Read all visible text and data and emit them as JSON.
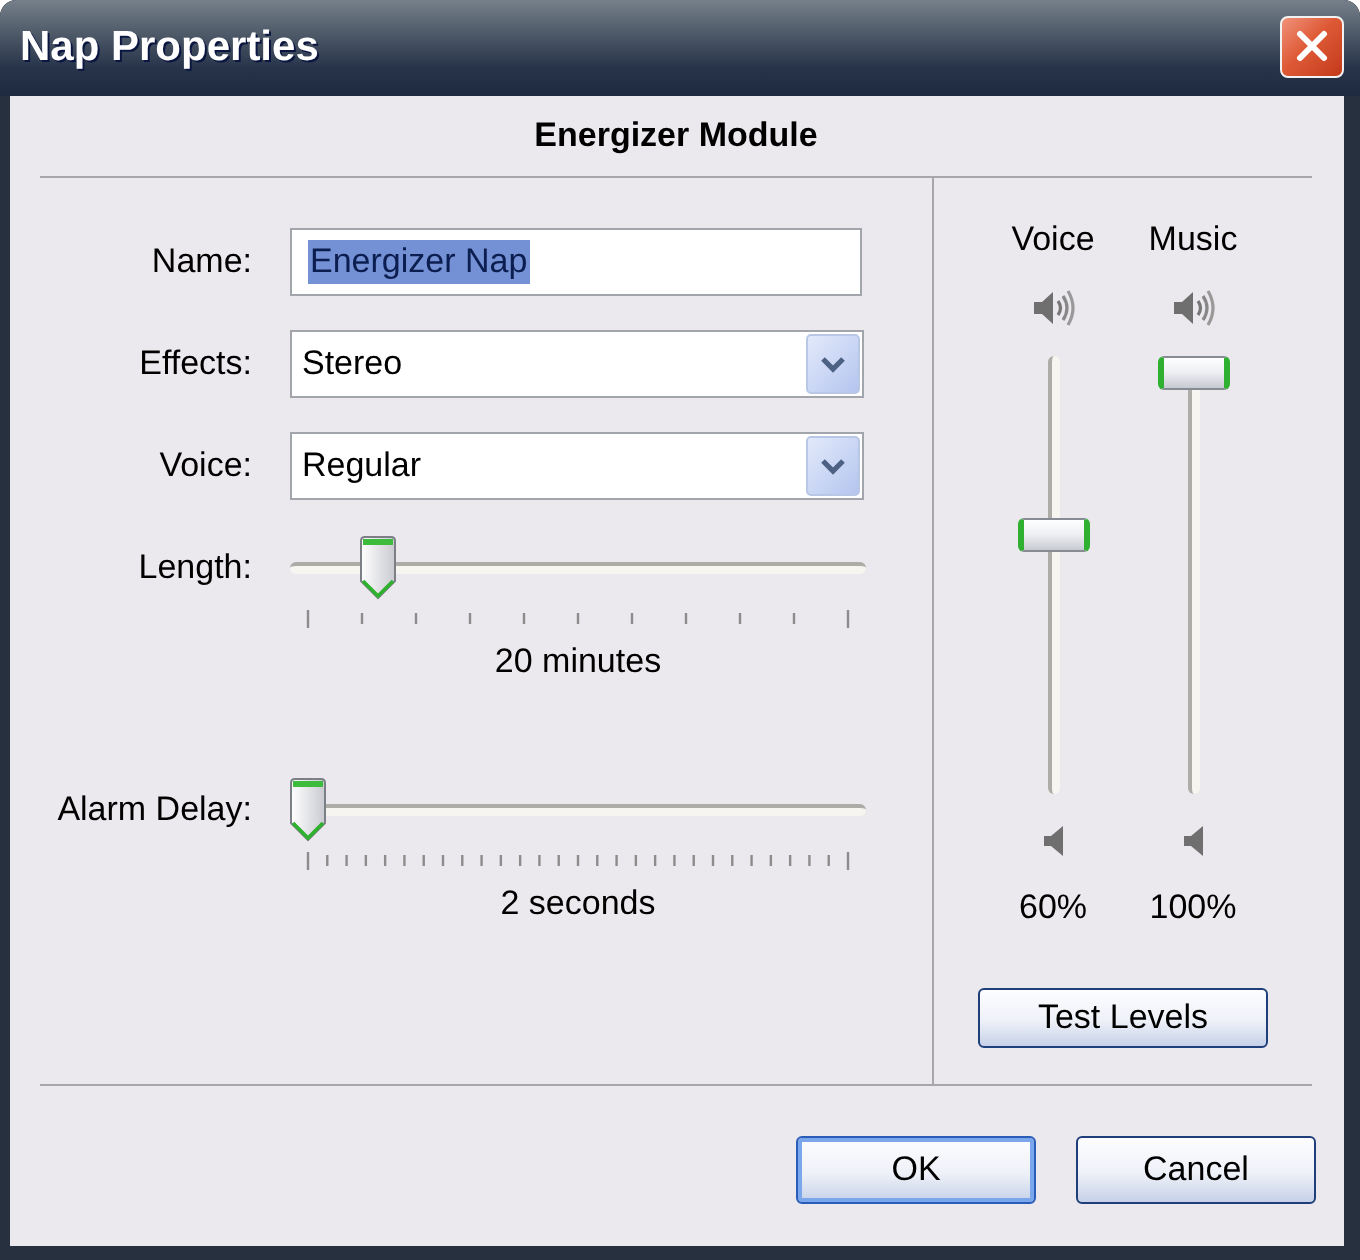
{
  "window": {
    "title": "Nap Properties"
  },
  "heading": "Energizer Module",
  "fields": [
    {
      "kind": "text",
      "label": "Name:",
      "value": "Energizer Nap",
      "value_selected": true
    },
    {
      "kind": "dropdown",
      "label": "Effects:",
      "value": "Stereo"
    },
    {
      "kind": "dropdown",
      "label": "Voice:",
      "value": "Regular"
    },
    {
      "kind": "slider",
      "label": "Length:",
      "level": 0.13,
      "reading": "20 minutes"
    },
    {
      "kind": "fineslider",
      "label": "Alarm Delay:",
      "level": 0,
      "reading": "2 seconds"
    }
  ],
  "levels": [
    {
      "label": "Voice",
      "level": 0.6,
      "reading": "60%"
    },
    {
      "label": "Music",
      "level": 1,
      "reading": "100%"
    }
  ],
  "test_button": {
    "label": "Test Levels"
  },
  "buttons": [
    {
      "label": "OK",
      "default": true
    },
    {
      "label": "Cancel",
      "default": false
    }
  ]
}
